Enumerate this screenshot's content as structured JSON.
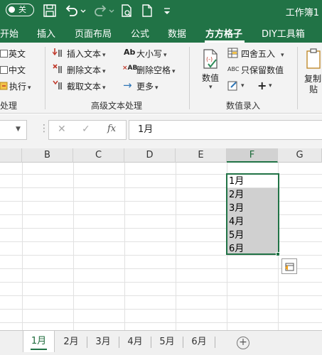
{
  "titlebar": {
    "autosave_label": "关",
    "workbook_title": "工作簿1"
  },
  "ribbon_tabs": [
    "开始",
    "插入",
    "页面布局",
    "公式",
    "数据",
    "方方格子",
    "DIY工具箱"
  ],
  "active_tab": "方方格子",
  "ribbon": {
    "left_group": {
      "items": [
        "英文",
        "中文",
        "执行"
      ],
      "label": "处理"
    },
    "text_group": {
      "items": [
        "插入文本",
        "删除文本",
        "截取文本",
        "大小写",
        "删除空格",
        "更多"
      ],
      "label": "高级文本处理"
    },
    "numeric_group": {
      "big_button": "数值",
      "items": [
        "四舍五入",
        "只保留数值"
      ],
      "label": "数值录入"
    },
    "clipboard": {
      "label_line1": "复制",
      "label_line2": "贴"
    }
  },
  "formula_bar": {
    "fx_label": "fx",
    "value": "1月"
  },
  "grid": {
    "columns": [
      "B",
      "C",
      "D",
      "E",
      "F",
      "G"
    ],
    "selected_column": "F",
    "cells": [
      "1月",
      "2月",
      "3月",
      "4月",
      "5月",
      "6月"
    ]
  },
  "sheets": [
    "1月",
    "2月",
    "3月",
    "4月",
    "5月",
    "6月"
  ],
  "active_sheet": "1月",
  "colors": {
    "accent": "#217346",
    "selection_fill": "#d0d0d0"
  }
}
